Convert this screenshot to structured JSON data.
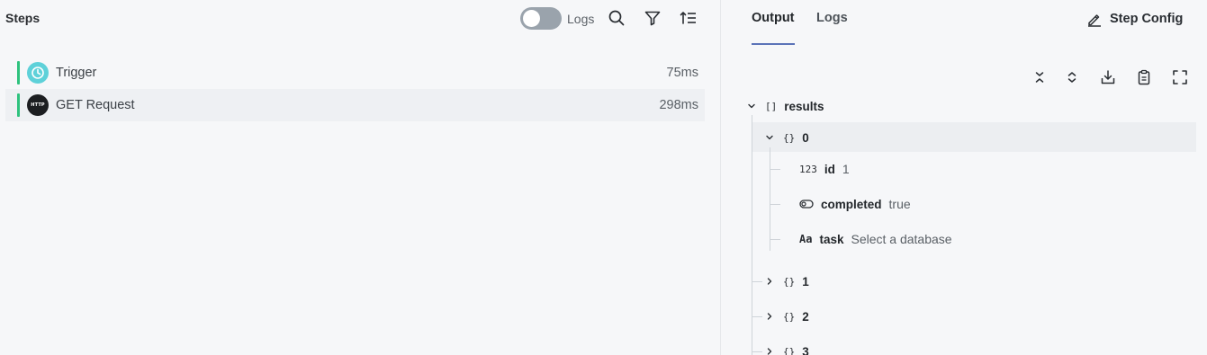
{
  "left_panel": {
    "title": "Steps",
    "logs_toggle": {
      "label": "Logs",
      "enabled": false
    },
    "toolbar": [
      "search-icon",
      "filter-icon",
      "sort-icon"
    ],
    "steps": [
      {
        "name": "Trigger",
        "duration": "75ms",
        "icon": "clock-icon",
        "icon_color": "#5ed1d9",
        "status_color": "#2ec27e"
      },
      {
        "name": "GET Request",
        "duration": "298ms",
        "icon": "http-icon",
        "icon_text": "HTTP",
        "status_color": "#2ec27e",
        "selected": true
      }
    ]
  },
  "right_panel": {
    "tabs": [
      {
        "label": "Output",
        "active": true
      },
      {
        "label": "Logs",
        "active": false
      }
    ],
    "step_config_label": "Step Config",
    "toolbar": [
      "collapse-all-icon",
      "expand-all-icon",
      "download-icon",
      "clipboard-icon",
      "fullscreen-icon"
    ],
    "tree": {
      "root": {
        "type_glyph": "[]",
        "key": "results",
        "expanded": true
      },
      "items": [
        {
          "type_glyph": "{}",
          "key": "0",
          "expanded": true,
          "selected": true,
          "fields": [
            {
              "type_glyph": "123",
              "key": "id",
              "value": "1"
            },
            {
              "type_glyph": "toggle",
              "key": "completed",
              "value": "true"
            },
            {
              "type_glyph": "Aa",
              "key": "task",
              "value": "Select a database"
            }
          ]
        },
        {
          "type_glyph": "{}",
          "key": "1",
          "expanded": false
        },
        {
          "type_glyph": "{}",
          "key": "2",
          "expanded": false
        },
        {
          "type_glyph": "{}",
          "key": "3",
          "expanded": false
        }
      ]
    }
  },
  "colors": {
    "accent_underline": "#5b73b8",
    "status_green": "#2ec27e",
    "background": "#f6f7f9"
  }
}
